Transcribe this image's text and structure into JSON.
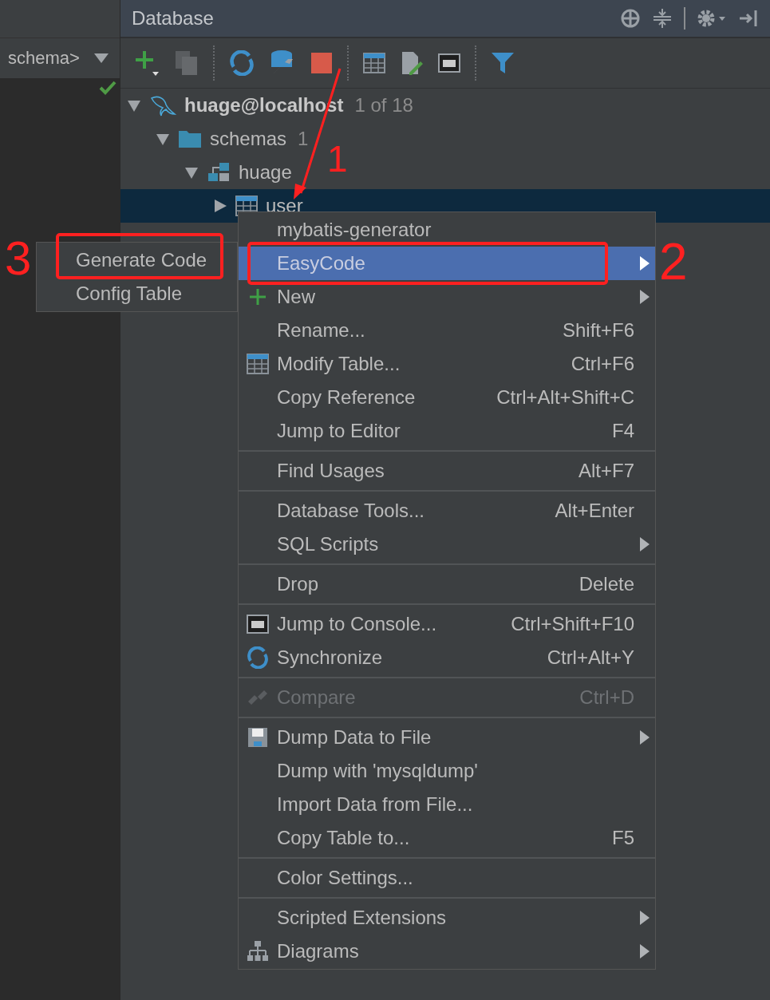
{
  "left_panel": {
    "schema_selector": "schema>"
  },
  "panel": {
    "title": "Database"
  },
  "tree": [
    {
      "label": "huage@localhost",
      "count": "1 of 18",
      "expanded": true,
      "selected": false,
      "children": [
        {
          "label": "schemas",
          "count": "1",
          "expanded": true,
          "selected": false,
          "children": [
            {
              "label": "huage",
              "expanded": true,
              "selected": false,
              "children": [
                {
                  "label": "user",
                  "expanded": false,
                  "selected": true
                }
              ]
            }
          ]
        }
      ]
    }
  ],
  "context_menu": {
    "groups": [
      [
        {
          "label": "mybatis-generator",
          "has_submenu": false,
          "disabled": false,
          "selected": false
        },
        {
          "label": "EasyCode",
          "has_submenu": true,
          "disabled": false,
          "selected": true
        },
        {
          "label": "New",
          "has_submenu": true,
          "disabled": false,
          "selected": false
        },
        {
          "label": "Rename...",
          "shortcut": "Shift+F6",
          "has_submenu": false,
          "disabled": false,
          "selected": false
        },
        {
          "label": "Modify Table...",
          "shortcut": "Ctrl+F6",
          "has_submenu": false,
          "disabled": false,
          "selected": false
        },
        {
          "label": "Copy Reference",
          "shortcut": "Ctrl+Alt+Shift+C",
          "has_submenu": false,
          "disabled": false,
          "selected": false
        },
        {
          "label": "Jump to Editor",
          "shortcut": "F4",
          "has_submenu": false,
          "disabled": false,
          "selected": false
        }
      ],
      [
        {
          "label": "Find Usages",
          "shortcut": "Alt+F7",
          "has_submenu": false,
          "disabled": false,
          "selected": false
        }
      ],
      [
        {
          "label": "Database Tools...",
          "shortcut": "Alt+Enter",
          "has_submenu": false,
          "disabled": false,
          "selected": false
        },
        {
          "label": "SQL Scripts",
          "has_submenu": true,
          "disabled": false,
          "selected": false
        }
      ],
      [
        {
          "label": "Drop",
          "shortcut": "Delete",
          "has_submenu": false,
          "disabled": false,
          "selected": false
        }
      ],
      [
        {
          "label": "Jump to Console...",
          "shortcut": "Ctrl+Shift+F10",
          "has_submenu": false,
          "disabled": false,
          "selected": false
        },
        {
          "label": "Synchronize",
          "shortcut": "Ctrl+Alt+Y",
          "has_submenu": false,
          "disabled": false,
          "selected": false
        }
      ],
      [
        {
          "label": "Compare",
          "shortcut": "Ctrl+D",
          "has_submenu": false,
          "disabled": true,
          "selected": false
        }
      ],
      [
        {
          "label": "Dump Data to File",
          "has_submenu": true,
          "disabled": false,
          "selected": false
        },
        {
          "label": "Dump with 'mysqldump'",
          "has_submenu": false,
          "disabled": false,
          "selected": false
        },
        {
          "label": "Import Data from File...",
          "has_submenu": false,
          "disabled": false,
          "selected": false
        },
        {
          "label": "Copy Table to...",
          "shortcut": "F5",
          "has_submenu": false,
          "disabled": false,
          "selected": false
        }
      ],
      [
        {
          "label": "Color Settings...",
          "has_submenu": false,
          "disabled": false,
          "selected": false
        }
      ],
      [
        {
          "label": "Scripted Extensions",
          "has_submenu": true,
          "disabled": false,
          "selected": false
        },
        {
          "label": "Diagrams",
          "has_submenu": true,
          "disabled": false,
          "selected": false
        }
      ]
    ]
  },
  "submenu": {
    "items": [
      {
        "label": "Generate Code",
        "selected": false
      },
      {
        "label": "Config Table",
        "selected": false
      }
    ]
  },
  "annotations": [
    {
      "label": "1"
    },
    {
      "label": "2"
    },
    {
      "label": "3"
    }
  ]
}
